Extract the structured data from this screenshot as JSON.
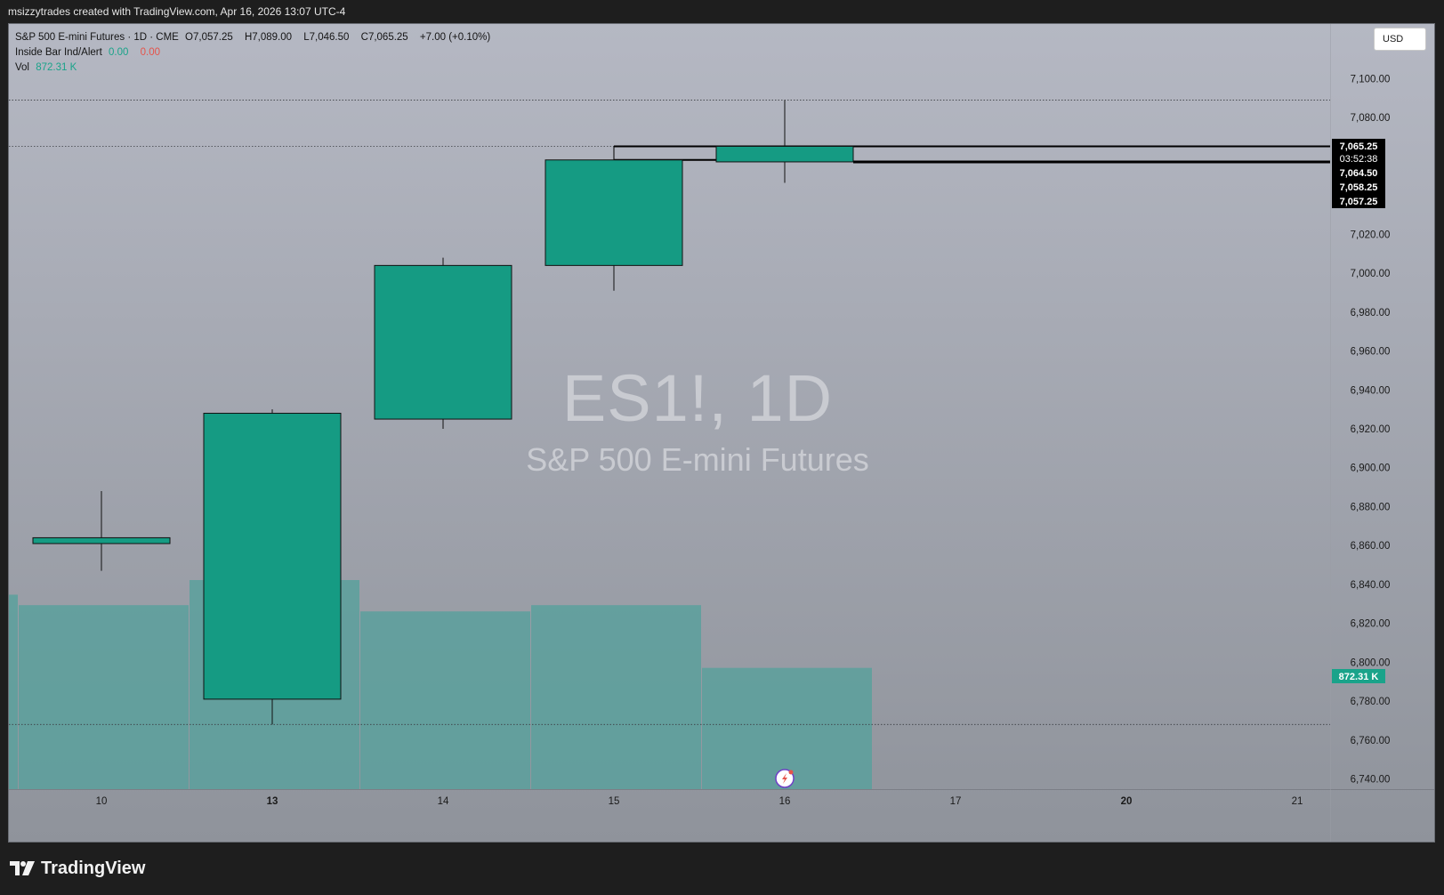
{
  "header": {
    "attribution": "msizzytrades created with TradingView.com, Apr 16, 2026 13:07 UTC-4"
  },
  "legend": {
    "symbol_line": "S&P 500 E-mini Futures · 1D · CME",
    "ohlc": {
      "o_label": "O",
      "o": "7,057.25",
      "h_label": "H",
      "h": "7,089.00",
      "l_label": "L",
      "l": "7,046.50",
      "c_label": "C",
      "c": "7,065.25",
      "change": "+7.00 (+0.10%)"
    },
    "indicator": {
      "name": "Inside Bar Ind/Alert",
      "v1": "0.00",
      "v2": "0.00"
    },
    "volume": {
      "name": "Vol",
      "value": "872.31 K"
    }
  },
  "watermark": {
    "ticker": "ES1!, 1D",
    "name": "S&P 500 E-mini Futures"
  },
  "currency_button": "USD",
  "price_scale": {
    "labels": [
      "7,100.00",
      "7,080.00",
      "7,020.00",
      "7,000.00",
      "6,980.00",
      "6,960.00",
      "6,940.00",
      "6,920.00",
      "6,900.00",
      "6,880.00",
      "6,860.00",
      "6,840.00",
      "6,820.00",
      "6,800.00",
      "6,780.00",
      "6,760.00",
      "6,740.00"
    ],
    "badges": [
      {
        "text": "7,065.25",
        "style": "dark"
      },
      {
        "text": "03:52:38",
        "style": "dark-small"
      },
      {
        "text": "7,064.50",
        "style": "dark"
      },
      {
        "text": "7,058.25",
        "style": "dark"
      },
      {
        "text": "7,057.25",
        "style": "dark"
      }
    ],
    "volume_badge": "872.31 K"
  },
  "time_scale": {
    "labels": [
      "10",
      "13",
      "14",
      "15",
      "16",
      "17",
      "20",
      "21"
    ],
    "bold_labels": [
      "13",
      "20"
    ]
  },
  "chart_data": {
    "type": "candlestick",
    "symbol": "ES1!",
    "interval": "1D",
    "categories": [
      "10",
      "13",
      "14",
      "15",
      "16"
    ],
    "ohlc": [
      {
        "date": "10",
        "open": 6864,
        "high": 6888,
        "low": 6847,
        "close": 6861
      },
      {
        "date": "13",
        "open": 6781,
        "high": 6930,
        "low": 6768,
        "close": 6928
      },
      {
        "date": "14",
        "open": 6925,
        "high": 7008,
        "low": 6920,
        "close": 7004
      },
      {
        "date": "15",
        "open": 7004,
        "high": 7058.25,
        "low": 6991,
        "close": 7058.25
      },
      {
        "date": "16",
        "open": 7057.25,
        "high": 7089.0,
        "low": 7046.5,
        "close": 7065.25
      }
    ],
    "volume_series": {
      "name": "Vol",
      "values_relative": [
        0.88,
        1.0,
        0.85,
        0.88,
        0.58
      ],
      "last_value": "872.31 K"
    },
    "y_range": [
      6740,
      7100
    ],
    "colors": {
      "candle": "#159b83",
      "volume": "#5aa09c",
      "volume_badge": "#1aa38a"
    }
  }
}
